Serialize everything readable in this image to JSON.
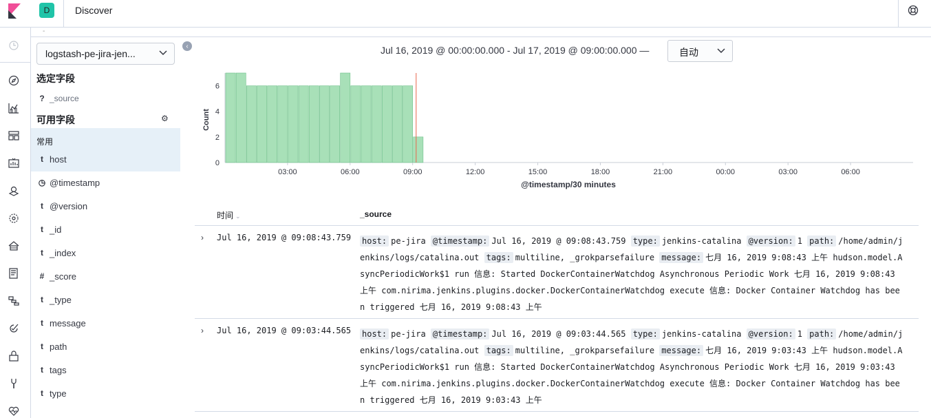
{
  "header": {
    "space_letter": "D",
    "title": "Discover"
  },
  "sidebar": {
    "index_pattern": "logstash-pe-jira-jen...",
    "selected_title": "选定字段",
    "selected_fields": [
      {
        "type": "?",
        "name": "_source"
      }
    ],
    "available_title": "可用字段",
    "popular_label": "常用",
    "fields": [
      {
        "type": "t",
        "name": "host"
      },
      {
        "type": "◷",
        "name": "@timestamp"
      },
      {
        "type": "t",
        "name": "@version"
      },
      {
        "type": "t",
        "name": "_id"
      },
      {
        "type": "t",
        "name": "_index"
      },
      {
        "type": "#",
        "name": "_score"
      },
      {
        "type": "t",
        "name": "_type"
      },
      {
        "type": "t",
        "name": "message"
      },
      {
        "type": "t",
        "name": "path"
      },
      {
        "type": "t",
        "name": "tags"
      },
      {
        "type": "t",
        "name": "type"
      }
    ]
  },
  "query": {
    "time_range": "Jul 16, 2019 @ 00:00:00.000 - Jul 17, 2019 @ 09:00:00.000 —",
    "interval": "自动"
  },
  "chart_data": {
    "type": "bar",
    "xlabel": "@timestamp/30 minutes",
    "ylabel": "Count",
    "ylim": [
      0,
      7
    ],
    "y_ticks": [
      0,
      2,
      4,
      6
    ],
    "x_ticks": [
      "03:00",
      "06:00",
      "09:00",
      "12:00",
      "15:00",
      "18:00",
      "21:00",
      "00:00",
      "03:00",
      "06:00"
    ],
    "values": [
      7,
      7,
      6,
      6,
      6,
      6,
      6,
      6,
      6,
      6,
      6,
      7,
      6,
      6,
      6,
      6,
      6,
      6,
      2
    ],
    "bar_color": "#a8e0b8",
    "current_time_marker": "09:10"
  },
  "table": {
    "col_time": "时间",
    "col_source": "_source",
    "rows": [
      {
        "time": "Jul 16, 2019 @ 09:08:43.759",
        "source": [
          {
            "k": "host:",
            "v": "pe-jira"
          },
          {
            "k": "@timestamp:",
            "v": "Jul 16, 2019 @ 09:08:43.759"
          },
          {
            "k": "type:",
            "v": "jenkins-catalina"
          },
          {
            "k": "@version:",
            "v": "1"
          },
          {
            "k": "path:",
            "v": "/home/admin/jenkins/logs/catalina.out"
          },
          {
            "k": "tags:",
            "v": "multiline, _grokparsefailure"
          },
          {
            "k": "message:",
            "v": "七月 16, 2019 9:08:43 上午 hudson.model.AsyncPeriodicWork$1 run 信息: Started DockerContainerWatchdog Asynchronous Periodic Work 七月 16, 2019 9:08:43 上午 com.nirima.jenkins.plugins.docker.DockerContainerWatchdog execute 信息: Docker Container Watchdog has been triggered 七月 16, 2019 9:08:43 上午"
          }
        ]
      },
      {
        "time": "Jul 16, 2019 @ 09:03:44.565",
        "source": [
          {
            "k": "host:",
            "v": "pe-jira"
          },
          {
            "k": "@timestamp:",
            "v": "Jul 16, 2019 @ 09:03:44.565"
          },
          {
            "k": "type:",
            "v": "jenkins-catalina"
          },
          {
            "k": "@version:",
            "v": "1"
          },
          {
            "k": "path:",
            "v": "/home/admin/jenkins/logs/catalina.out"
          },
          {
            "k": "tags:",
            "v": "multiline, _grokparsefailure"
          },
          {
            "k": "message:",
            "v": "七月 16, 2019 9:03:43 上午 hudson.model.AsyncPeriodicWork$1 run 信息: Started DockerContainerWatchdog Asynchronous Periodic Work 七月 16, 2019 9:03:43 上午 com.nirima.jenkins.plugins.docker.DockerContainerWatchdog execute 信息: Docker Container Watchdog has been triggered 七月 16, 2019 9:03:43 上午"
          }
        ]
      }
    ]
  },
  "nav_icons": [
    "clock-icon",
    "discover-icon",
    "visualize-icon",
    "dashboard-icon",
    "canvas-icon",
    "maps-icon",
    "ml-icon",
    "infrastructure-icon",
    "logs-icon",
    "apm-icon",
    "uptime-icon",
    "security-icon",
    "dev-tools-icon",
    "monitoring-icon"
  ]
}
